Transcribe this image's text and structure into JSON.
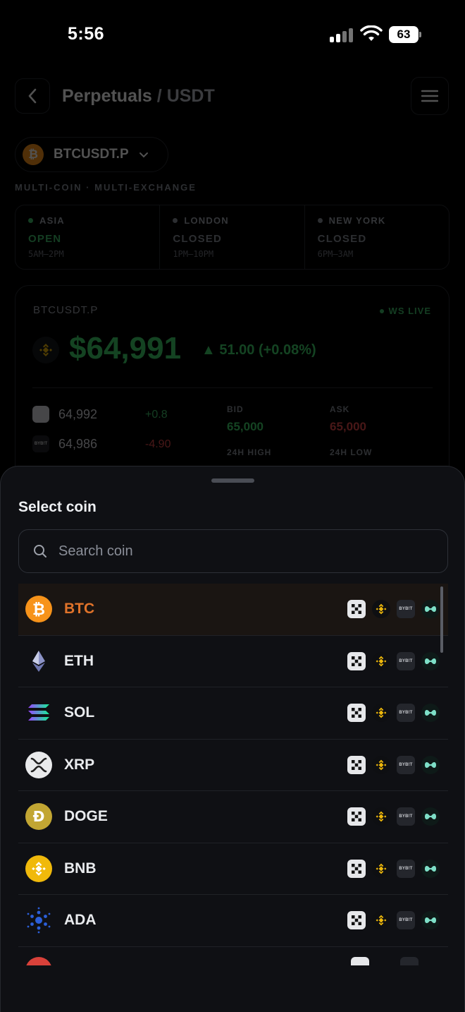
{
  "status_bar": {
    "time": "5:56",
    "battery": "63"
  },
  "header": {
    "title_main": "Perpetuals",
    "title_sep": " / ",
    "title_quote": "USDT"
  },
  "pair_selector": {
    "label": "BTCUSDT.P",
    "coin_glyph": "₿"
  },
  "subtitle": "MULTI-COIN · MULTI-EXCHANGE",
  "sessions": [
    {
      "name": "ASIA",
      "state": "OPEN",
      "hours": "5AM–2PM",
      "color": "#3fbf6a"
    },
    {
      "name": "LONDON",
      "state": "CLOSED",
      "hours": "1PM–10PM",
      "color": "#8a8e98"
    },
    {
      "name": "NEW YORK",
      "state": "CLOSED",
      "hours": "6PM–3AM",
      "color": "#8a8e98"
    }
  ],
  "ticker": {
    "symbol": "BTCUSDT.P",
    "live": "WS LIVE",
    "price": "$64,991",
    "change": "▲ 51.00 (+0.08%)",
    "feeds": [
      {
        "exchange_icon": "okx-icon",
        "price": "64,992",
        "delta": "+0.8",
        "delta_color": "#3fbf6a"
      },
      {
        "exchange_icon": "bybit-icon",
        "price": "64,986",
        "delta": "-4.90",
        "delta_color": "#e04a4a"
      }
    ],
    "stats": {
      "bid_label": "BID",
      "bid": "65,000",
      "ask_label": "ASK",
      "ask": "65,000",
      "high_label": "24H HIGH",
      "low_label": "24H LOW"
    }
  },
  "sheet": {
    "title": "Select coin",
    "search_placeholder": "Search coin",
    "coins": [
      {
        "symbol": "BTC",
        "icon": "btc-icon",
        "selected": true
      },
      {
        "symbol": "ETH",
        "icon": "eth-icon",
        "selected": false
      },
      {
        "symbol": "SOL",
        "icon": "sol-icon",
        "selected": false
      },
      {
        "symbol": "XRP",
        "icon": "xrp-icon",
        "selected": false
      },
      {
        "symbol": "DOGE",
        "icon": "doge-icon",
        "selected": false
      },
      {
        "symbol": "BNB",
        "icon": "bnb-icon",
        "selected": false
      },
      {
        "symbol": "ADA",
        "icon": "ada-icon",
        "selected": false
      }
    ],
    "venue_labels": {
      "bybit": "BYB!T"
    }
  },
  "colors": {
    "accent_orange": "#e0732a",
    "positive_green": "#3fcf6a",
    "negative_red": "#e04a4a"
  }
}
